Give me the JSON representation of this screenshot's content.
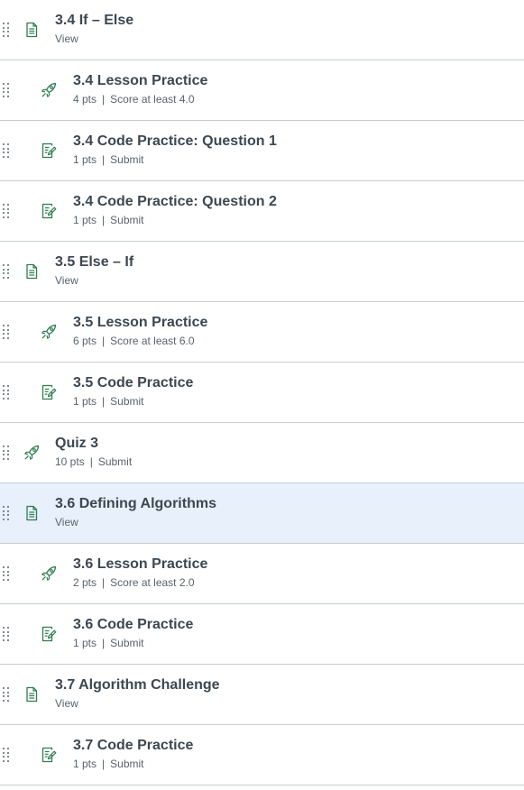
{
  "items": [
    {
      "title": "3.4 If – Else",
      "meta": [
        "View"
      ],
      "icon": "page-icon",
      "indent": 0
    },
    {
      "title": "3.4 Lesson Practice",
      "meta": [
        "4 pts",
        "Score at least 4.0"
      ],
      "icon": "rocket-icon",
      "indent": 1
    },
    {
      "title": "3.4 Code Practice: Question 1",
      "meta": [
        "1 pts",
        "Submit"
      ],
      "icon": "assignment-icon",
      "indent": 1
    },
    {
      "title": "3.4 Code Practice: Question 2",
      "meta": [
        "1 pts",
        "Submit"
      ],
      "icon": "assignment-icon",
      "indent": 1
    },
    {
      "title": "3.5 Else – If",
      "meta": [
        "View"
      ],
      "icon": "page-icon",
      "indent": 0
    },
    {
      "title": "3.5 Lesson Practice",
      "meta": [
        "6 pts",
        "Score at least 6.0"
      ],
      "icon": "rocket-icon",
      "indent": 1
    },
    {
      "title": "3.5 Code Practice",
      "meta": [
        "1 pts",
        "Submit"
      ],
      "icon": "assignment-icon",
      "indent": 1
    },
    {
      "title": "Quiz 3",
      "meta": [
        "10 pts",
        "Submit"
      ],
      "icon": "rocket-icon",
      "indent": 0
    },
    {
      "title": "3.6 Defining Algorithms",
      "meta": [
        "View"
      ],
      "icon": "page-icon",
      "indent": 0,
      "highlighted": true
    },
    {
      "title": "3.6 Lesson Practice",
      "meta": [
        "2 pts",
        "Score at least 2.0"
      ],
      "icon": "rocket-icon",
      "indent": 1
    },
    {
      "title": "3.6 Code Practice",
      "meta": [
        "1 pts",
        "Submit"
      ],
      "icon": "assignment-icon",
      "indent": 1
    },
    {
      "title": "3.7 Algorithm Challenge",
      "meta": [
        "View"
      ],
      "icon": "page-icon",
      "indent": 0
    },
    {
      "title": "3.7 Code Practice",
      "meta": [
        "1 pts",
        "Submit"
      ],
      "icon": "assignment-icon",
      "indent": 1
    }
  ],
  "colors": {
    "icon_green": "#2e7d4f",
    "highlight_bg": "#e8f1fb",
    "divider": "#c7cdd1"
  }
}
